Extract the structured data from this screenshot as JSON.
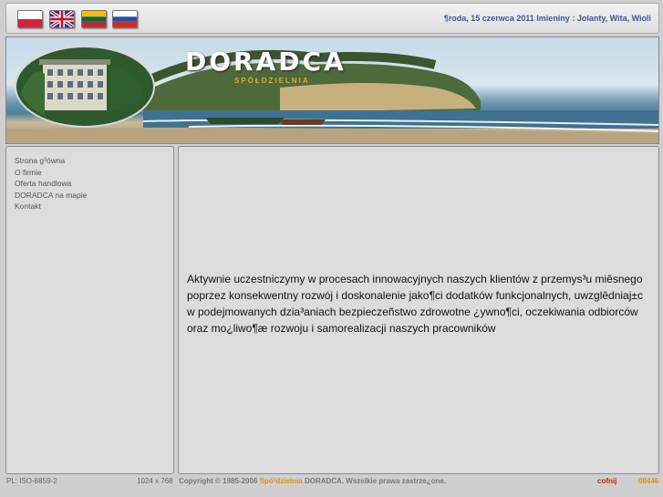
{
  "header": {
    "flags": [
      {
        "name": "Polski",
        "icon": "flag-pl-icon"
      },
      {
        "name": "English",
        "icon": "flag-gb-icon"
      },
      {
        "name": "Lietuvių",
        "icon": "flag-lt-icon"
      },
      {
        "name": "Русский",
        "icon": "flag-ru-icon"
      }
    ],
    "date_text": "¶roda, 15 czerwca 2011  Imieniny : Jolanty, Wita, Wioli"
  },
  "banner": {
    "title": "DORADCA",
    "subtitle": "SPÓŁDZIELNIA"
  },
  "sidebar": {
    "items": [
      {
        "label": "Strona g³ówna"
      },
      {
        "label": "O firmie"
      },
      {
        "label": "Oferta handlowa"
      },
      {
        "label": "DORADCA na mapie"
      },
      {
        "label": "Kontakt"
      }
    ]
  },
  "main": {
    "text": "Aktywnie uczestniczymy w procesach innowacyjnych naszych klientów z przemys³u miêsnego poprzez konsekwentny rozwój i doskonalenie jako¶ci dodatków funkcjonalnych, uwzglêdniaj±c w podejmowanych dzia³aniach bezpieczeñstwo zdrowotne ¿ywno¶ci, oczekiwania odbiorców oraz mo¿liwo¶æ rozwoju i samorealizacji naszych pracowników"
  },
  "footer": {
    "encoding": "PL: ISO-8859-2",
    "resolution": "1024 x 768",
    "copyright_prefix": "Copyright © 1985-2006 ",
    "copyright_brand": "Spó³dzielnia",
    "copyright_suffix": " DORADCA. Wszelkie prawa zastrze¿one.",
    "back_label": "cofnij",
    "counter": "08446"
  },
  "colors": {
    "date": "#3a5a9a",
    "brand_orange": "#e88a1a",
    "back_red": "#cc2200"
  }
}
